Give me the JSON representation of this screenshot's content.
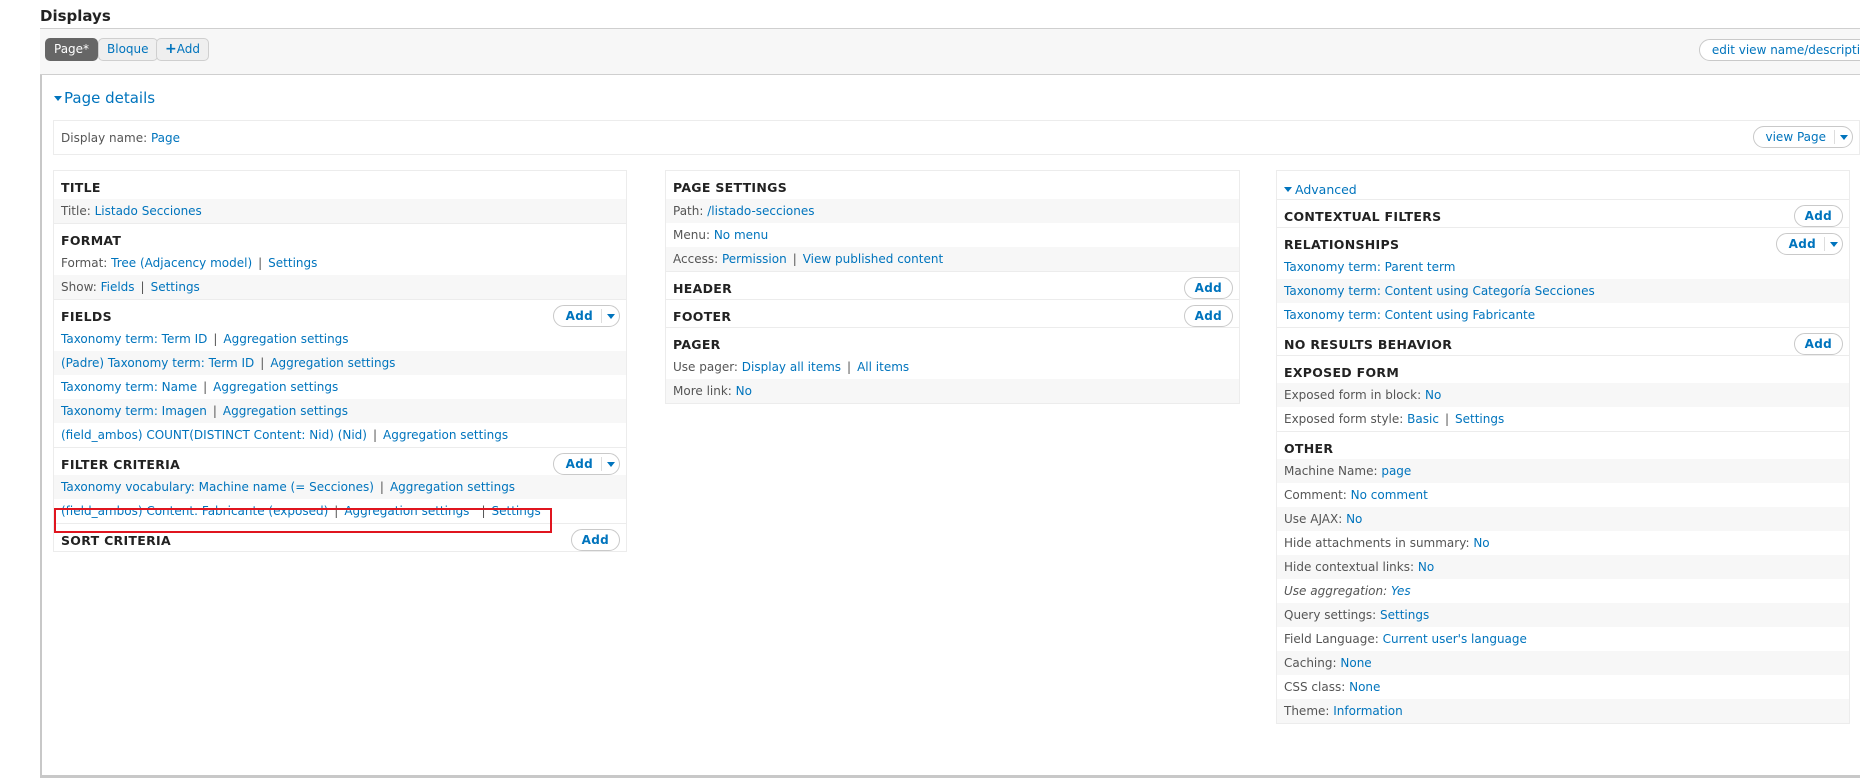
{
  "header": {
    "title": "Displays"
  },
  "tabs": [
    {
      "label": "Page*",
      "active": true
    },
    {
      "label": "Bloque",
      "active": false
    },
    {
      "label": "Add",
      "icon": "plus-icon"
    }
  ],
  "edit_view_button": "edit view name/description",
  "page_details": {
    "toggle_label": "Page details",
    "display_name_label": "Display name:",
    "display_name_value": "Page",
    "view_page_button": "view Page"
  },
  "left": {
    "title": {
      "heading": "TITLE",
      "rows": [
        {
          "label": "Title:",
          "value": "Listado Secciones"
        }
      ]
    },
    "format": {
      "heading": "FORMAT",
      "format_label": "Format:",
      "format_value": "Tree (Adjacency model)",
      "format_settings": "Settings",
      "show_label": "Show:",
      "show_value": "Fields",
      "show_settings": "Settings"
    },
    "fields": {
      "heading": "FIELDS",
      "add": "Add",
      "items": [
        {
          "name": "Taxonomy term: Term ID",
          "extra": "Aggregation settings"
        },
        {
          "name": "(Padre) Taxonomy term: Term ID",
          "extra": "Aggregation settings"
        },
        {
          "name": "Taxonomy term: Name",
          "extra": "Aggregation settings"
        },
        {
          "name": "Taxonomy term: Imagen",
          "extra": "Aggregation settings"
        },
        {
          "name": "(field_ambos) COUNT(DISTINCT Content: Nid) (Nid)",
          "extra": "Aggregation settings"
        }
      ]
    },
    "filters": {
      "heading": "FILTER CRITERIA",
      "add": "Add",
      "items": [
        {
          "name": "Taxonomy vocabulary: Machine name (= Secciones)",
          "extra": "Aggregation settings"
        },
        {
          "name": "(field_ambos) Content: Fabricante (exposed)",
          "extra": "Aggregation settings",
          "extra2": "Settings",
          "highlighted": true
        }
      ]
    },
    "sort": {
      "heading": "SORT CRITERIA",
      "add": "Add"
    }
  },
  "middle": {
    "page_settings": {
      "heading": "PAGE SETTINGS",
      "path_label": "Path:",
      "path_value": "/listado-secciones",
      "menu_label": "Menu:",
      "menu_value": "No menu",
      "access_label": "Access:",
      "access_value": "Permission",
      "access_value2": "View published content"
    },
    "header": {
      "heading": "HEADER",
      "add": "Add"
    },
    "footer": {
      "heading": "FOOTER",
      "add": "Add"
    },
    "pager": {
      "heading": "PAGER",
      "use_pager_label": "Use pager:",
      "use_pager_value": "Display all items",
      "use_pager_value2": "All items",
      "more_link_label": "More link:",
      "more_link_value": "No"
    }
  },
  "right": {
    "advanced_label": "Advanced",
    "contextual_filters": {
      "heading": "CONTEXTUAL FILTERS",
      "add": "Add"
    },
    "relationships": {
      "heading": "RELATIONSHIPS",
      "add": "Add",
      "items": [
        "Taxonomy term: Parent term",
        "Taxonomy term: Content using Categoría Secciones",
        "Taxonomy term: Content using Fabricante"
      ]
    },
    "no_results": {
      "heading": "NO RESULTS BEHAVIOR",
      "add": "Add"
    },
    "exposed_form": {
      "heading": "EXPOSED FORM",
      "in_block_label": "Exposed form in block:",
      "in_block_value": "No",
      "style_label": "Exposed form style:",
      "style_value": "Basic",
      "style_settings": "Settings"
    },
    "other": {
      "heading": "OTHER",
      "rows": [
        {
          "label": "Machine Name:",
          "value": "page"
        },
        {
          "label": "Comment:",
          "value": "No comment"
        },
        {
          "label": "Use AJAX:",
          "value": "No"
        },
        {
          "label": "Hide attachments in summary:",
          "value": "No"
        },
        {
          "label": "Hide contextual links:",
          "value": "No"
        },
        {
          "label": "Use aggregation:",
          "value": "Yes"
        },
        {
          "label": "Query settings:",
          "value": "Settings"
        },
        {
          "label": "Field Language:",
          "value": "Current user's language"
        },
        {
          "label": "Caching:",
          "value": "None"
        },
        {
          "label": "CSS class:",
          "value": "None"
        },
        {
          "label": "Theme:",
          "value": "Information"
        }
      ]
    }
  },
  "colors": {
    "link": "#0074bd",
    "active_tab": "#666666",
    "highlight": "#e0151f"
  }
}
